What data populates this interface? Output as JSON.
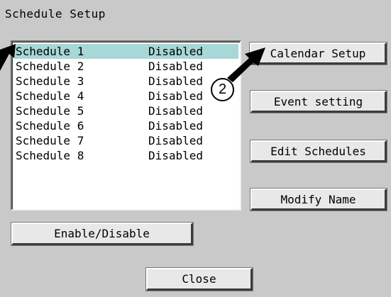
{
  "window": {
    "title": "Schedule Setup"
  },
  "schedules": [
    {
      "name": "Schedule 1",
      "status": "Disabled"
    },
    {
      "name": "Schedule 2",
      "status": "Disabled"
    },
    {
      "name": "Schedule 3",
      "status": "Disabled"
    },
    {
      "name": "Schedule 4",
      "status": "Disabled"
    },
    {
      "name": "Schedule 5",
      "status": "Disabled"
    },
    {
      "name": "Schedule 6",
      "status": "Disabled"
    },
    {
      "name": "Schedule 7",
      "status": "Disabled"
    },
    {
      "name": "Schedule 8",
      "status": "Disabled"
    }
  ],
  "buttons": {
    "calendar_setup": "Calendar Setup",
    "event_setting": "Event setting",
    "edit_schedules": "Edit Schedules",
    "modify_name": "Modify Name",
    "enable_disable": "Enable/Disable",
    "close": "Close"
  },
  "callout": {
    "number": "2"
  },
  "colors": {
    "selection": "#a7d7d6",
    "background": "#c9c9c9"
  },
  "icons": {
    "pointer_left": "arrow-icon",
    "pointer_callout": "arrow-icon"
  }
}
